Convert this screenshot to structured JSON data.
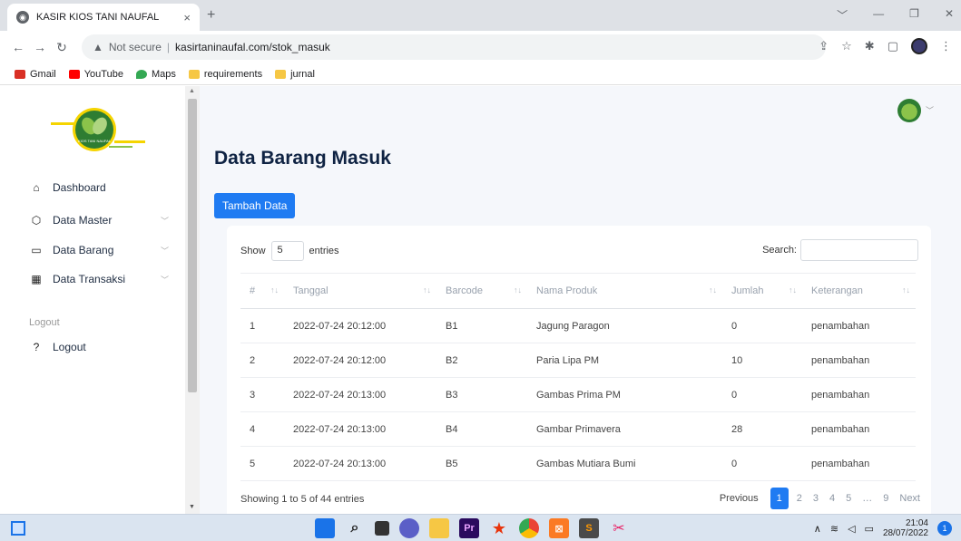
{
  "browser": {
    "tab_title": "KASIR KIOS TANI NAUFAL",
    "tab_close": "×",
    "new_tab": "+",
    "security": "Not secure",
    "url": "kasirtaninaufal.com/stok_masuk",
    "bookmarks": [
      {
        "label": "Gmail",
        "color": "#d93025"
      },
      {
        "label": "YouTube",
        "color": "#ff0000"
      },
      {
        "label": "Maps",
        "color": "#34a853"
      },
      {
        "label": "requirements",
        "color": "#f6c744"
      },
      {
        "label": "jurnal",
        "color": "#f6c744"
      }
    ]
  },
  "sidebar": {
    "items": [
      {
        "label": "Dashboard",
        "icon": "home-icon"
      },
      {
        "label": "Data Master",
        "icon": "box-icon"
      },
      {
        "label": "Data Barang",
        "icon": "credit-card-icon"
      },
      {
        "label": "Data Transaksi",
        "icon": "grid-icon"
      }
    ],
    "section_header": "Logout",
    "logout_label": "Logout",
    "logo_text": "KIOS TANI NAUFAL"
  },
  "main": {
    "title": "Data Barang Masuk",
    "add_button": "Tambah Data",
    "show_label": "Show",
    "entries_value": "5",
    "entries_label": "entries",
    "search_label": "Search:",
    "columns": [
      "#",
      "Tanggal",
      "Barcode",
      "Nama Produk",
      "Jumlah",
      "Keterangan"
    ],
    "rows": [
      [
        "1",
        "2022-07-24 20:12:00",
        "B1",
        "Jagung Paragon",
        "0",
        "penambahan"
      ],
      [
        "2",
        "2022-07-24 20:12:00",
        "B2",
        "Paria Lipa PM",
        "10",
        "penambahan"
      ],
      [
        "3",
        "2022-07-24 20:13:00",
        "B3",
        "Gambas Prima PM",
        "0",
        "penambahan"
      ],
      [
        "4",
        "2022-07-24 20:13:00",
        "B4",
        "Gambar Primavera",
        "28",
        "penambahan"
      ],
      [
        "5",
        "2022-07-24 20:13:00",
        "B5",
        "Gambas Mutiara Bumi",
        "0",
        "penambahan"
      ]
    ],
    "info": "Showing 1 to 5 of 44 entries",
    "pager": {
      "previous": "Previous",
      "pages": [
        "1",
        "2",
        "3",
        "4",
        "5",
        "…",
        "9"
      ],
      "active_page": "1",
      "next": "Next"
    }
  },
  "taskbar": {
    "time": "21:04",
    "date": "28/07/2022",
    "notifications": "1"
  },
  "colors": {
    "accent": "#1f7bf2",
    "title": "#0f2343",
    "page_bg": "#f5f7fb"
  }
}
